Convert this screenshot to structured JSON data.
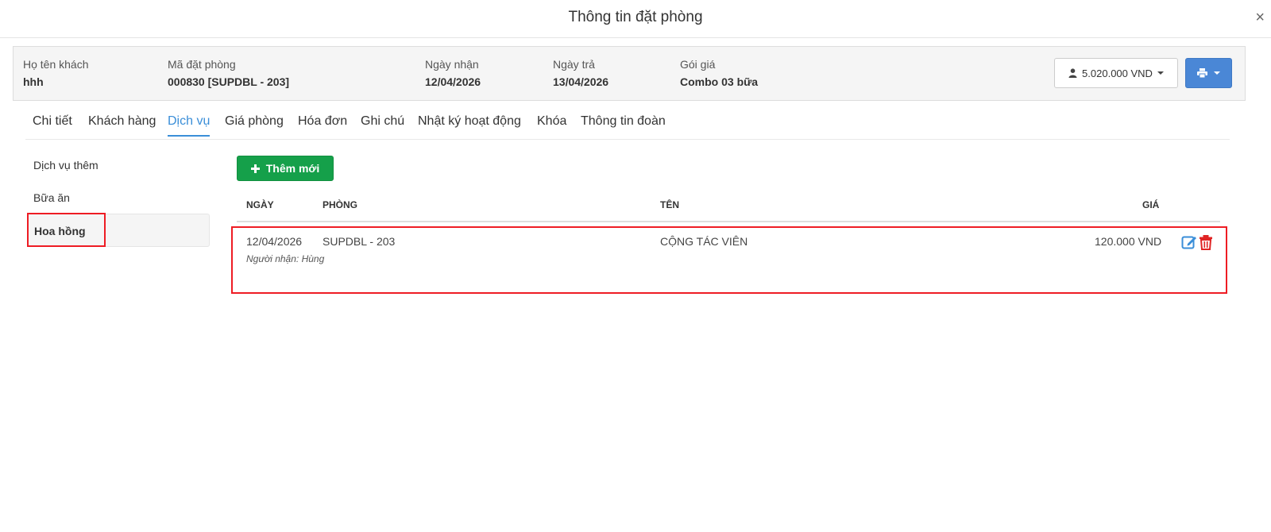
{
  "modal": {
    "title": "Thông tin đặt phòng",
    "close": "×"
  },
  "info": {
    "guest_label": "Họ tên khách",
    "guest_value": "hhh",
    "booking_label": "Mã đặt phòng",
    "booking_value": "000830 [SUPDBL - 203]",
    "checkin_label": "Ngày nhận",
    "checkin_value": "12/04/2026",
    "checkout_label": "Ngày trả",
    "checkout_value": "13/04/2026",
    "package_label": "Gói giá",
    "package_value": "Combo 03 bữa",
    "amount": "5.020.000 VND"
  },
  "tabs": [
    "Chi tiết",
    "Khách hàng",
    "Dịch vụ",
    "Giá phòng",
    "Hóa đơn",
    "Ghi chú",
    "Nhật ký hoạt động",
    "Khóa",
    "Thông tin đoàn"
  ],
  "active_tab": "Dịch vụ",
  "sidebar": {
    "items": [
      "Dịch vụ thêm",
      "Bữa ăn",
      "Hoa hồng"
    ],
    "active": "Hoa hồng"
  },
  "add_button": "Thêm mới",
  "table": {
    "headers": {
      "date": "NGÀY",
      "room": "PHÒNG",
      "name": "TÊN",
      "price": "GIÁ"
    },
    "rows": [
      {
        "date": "12/04/2026",
        "room": "SUPDBL - 203",
        "name": "CỘNG TÁC VIÊN",
        "price": "120.000 VND",
        "note": "Người nhận: Hùng"
      }
    ]
  },
  "icons": [
    "close-icon",
    "user-icon",
    "print-icon",
    "plus-icon",
    "edit-icon",
    "trash-icon"
  ],
  "colors": {
    "primary": "#4a87d6",
    "success": "#15a04a",
    "tab_active": "#3a8ed8",
    "danger": "#e02424",
    "highlight": "#ee1c24"
  }
}
